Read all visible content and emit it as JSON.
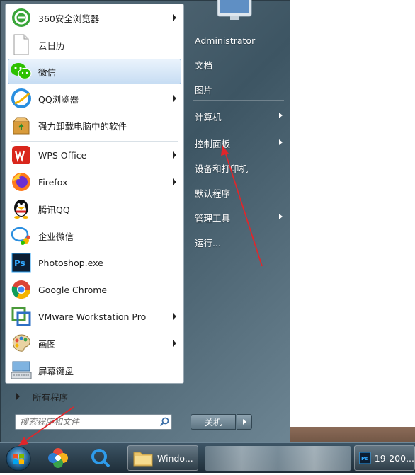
{
  "programs": [
    {
      "label": "360安全浏览器",
      "icon": "360-browser-icon",
      "arrow": true
    },
    {
      "label": "云日历",
      "icon": "blank-document-icon",
      "arrow": false
    },
    {
      "label": "微信",
      "icon": "wechat-icon",
      "arrow": false,
      "highlight": true
    },
    {
      "label": "QQ浏览器",
      "icon": "qq-browser-icon",
      "arrow": true
    },
    {
      "label": "强力卸载电脑中的软件",
      "icon": "uninstall-box-icon",
      "arrow": false
    },
    {
      "label": "WPS Office",
      "icon": "wps-office-icon",
      "arrow": true
    },
    {
      "label": "Firefox",
      "icon": "firefox-icon",
      "arrow": true
    },
    {
      "label": "腾讯QQ",
      "icon": "qq-penguin-icon",
      "arrow": false
    },
    {
      "label": "企业微信",
      "icon": "wecom-icon",
      "arrow": false
    },
    {
      "label": "Photoshop.exe",
      "icon": "photoshop-icon",
      "arrow": false
    },
    {
      "label": "Google Chrome",
      "icon": "chrome-icon",
      "arrow": false
    },
    {
      "label": "VMware Workstation Pro",
      "icon": "vmware-icon",
      "arrow": true
    },
    {
      "label": "画图",
      "icon": "paint-palette-icon",
      "arrow": true
    },
    {
      "label": "屏幕键盘",
      "icon": "onscreen-keyboard-icon",
      "arrow": false
    }
  ],
  "all_programs": "所有程序",
  "search": {
    "placeholder": "搜索程序和文件"
  },
  "right_items": [
    {
      "label": "Administrator",
      "arrow": false
    },
    {
      "label": "文档",
      "arrow": false
    },
    {
      "label": "图片",
      "arrow": false
    },
    {
      "label": "计算机",
      "arrow": true
    },
    {
      "label": "控制面板",
      "arrow": true
    },
    {
      "label": "设备和打印机",
      "arrow": false
    },
    {
      "label": "默认程序",
      "arrow": false
    },
    {
      "label": "管理工具",
      "arrow": true
    },
    {
      "label": "运行...",
      "arrow": false
    }
  ],
  "shutdown": {
    "label": "关机"
  },
  "taskbar": {
    "explorer_task": "Windo...",
    "photoshop_task": "19-200..."
  },
  "colors": {
    "highlight": "#c7ddf3",
    "annotation_arrow": "#e0262b",
    "taskbar": "#2a3d4a"
  }
}
